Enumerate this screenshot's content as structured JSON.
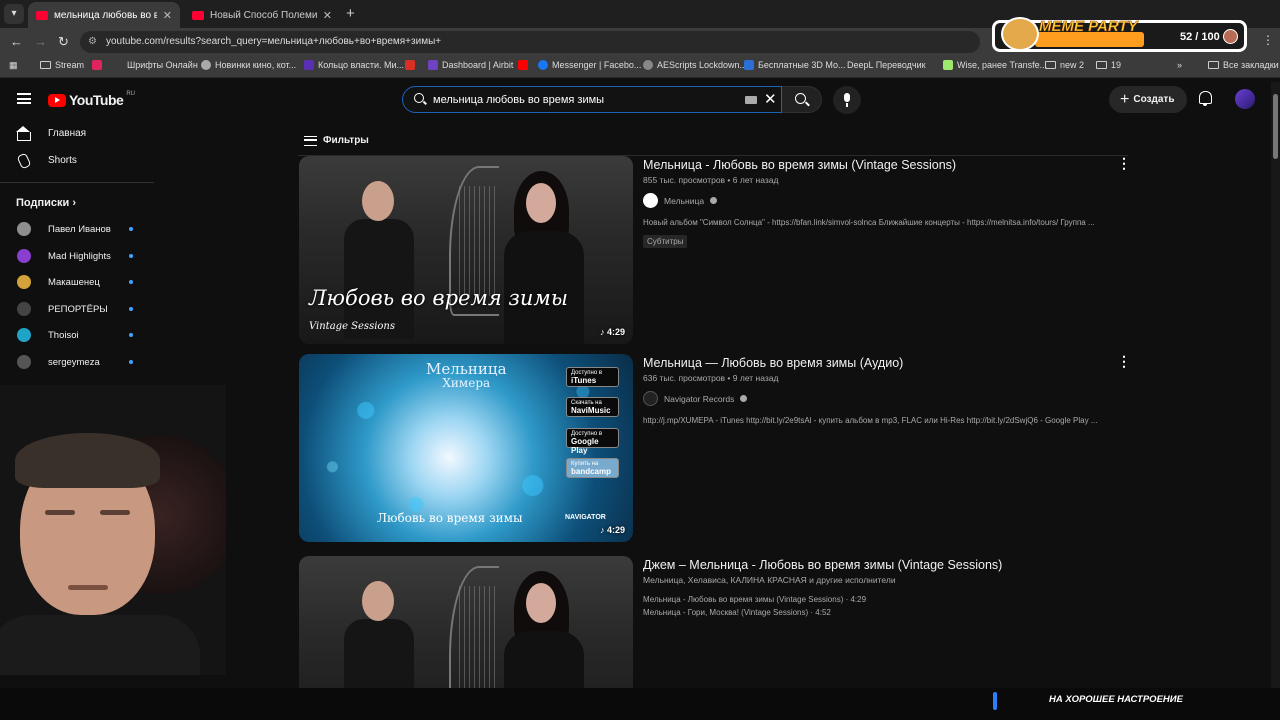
{
  "browser": {
    "tabs": [
      {
        "title": "мельница любовь во время з"
      },
      {
        "title": "Новый Способ Полемики Ра..."
      }
    ],
    "url": "youtube.com/results?search_query=мельница+любовь+во+время+зимы+",
    "bookmarks": [
      "Stream",
      "Шрифты Онлайн",
      "Новинки кино, кот...",
      "Кольцо власти. Ми...",
      "Dashboard | Airbit",
      "Messenger | Facebo...",
      "AEScripts Lockdown...",
      "Бесплатные 3D Мо...",
      "DeepL Переводчик",
      "Wise, ранее Transfe...",
      "new 2",
      "19",
      "Все закладки"
    ]
  },
  "overlay": {
    "title": "MEME PARTY",
    "count": "52 / 100",
    "progress": 0.52
  },
  "youtube": {
    "logo": "YouTube",
    "region": "RU",
    "search_value": "мельница любовь во время зимы",
    "create_label": "Создать",
    "sidebar": {
      "home": "Главная",
      "shorts": "Shorts",
      "subs_title": "Подписки",
      "subscriptions": [
        {
          "name": "Павел Иванов",
          "color": "#8f8f8f"
        },
        {
          "name": "Mad Highlights",
          "color": "#8b3fd1"
        },
        {
          "name": "Макашенец",
          "color": "#d4a23a"
        },
        {
          "name": "РЕПОРТЁРЫ",
          "color": "#444444"
        },
        {
          "name": "Thoisoi",
          "color": "#1fa3c7"
        },
        {
          "name": "sergeymeza",
          "color": "#555555"
        }
      ]
    },
    "filters_label": "Фильтры",
    "results": [
      {
        "title": "Мельница - Любовь во время зимы (Vintage Sessions)",
        "meta": "855 тыс. просмотров • 6 лет назад",
        "channel": "Мельница",
        "description": "Новый альбом \"Символ Солнца\" - https://bfan.link/simvol-solnca Ближайшие концерты - https://melnitsa.info/tours/ Группа ...",
        "badge": "Субтитры",
        "duration": "4:29",
        "overlay_title": "Любовь во время зимы",
        "overlay_sub": "Vintage Sessions"
      },
      {
        "title": "Мельница — Любовь во время зимы (Аудио)",
        "meta": "636 тыс. просмотров • 9 лет назад",
        "channel": "Navigator Records",
        "description": "http://j.mp/XUMEPA - iTunes http://bit.ly/2e9tsAl - купить альбом в mp3, FLAC или Hi-Res http://bit.ly/2dSwjQ6 - Google Play ...",
        "duration": "4:29",
        "art_title": "Мельница",
        "art_subtitle": "Химера",
        "art_bottom": "Любовь во время зимы",
        "art_label": "NAVIGATOR",
        "stores": [
          {
            "small": "Доступно в",
            "big": "iTunes"
          },
          {
            "small": "Скачать на",
            "big": "NaviMusic"
          },
          {
            "small": "Доступно в",
            "big": "Google Play"
          },
          {
            "small": "Купить на",
            "big": "bandcamp"
          }
        ]
      },
      {
        "title": "Джем – Мельница - Любовь во время зимы (Vintage Sessions)",
        "meta": "Мельница, Хелависа, КАЛИНА КРАСНАЯ и другие исполнители",
        "line1": "Мельница - Любовь во время зимы (Vintage Sessions) · 4:29",
        "line2": "Мельница - Гори, Москва! (Vintage Sessions) · 4:52"
      }
    ]
  },
  "bottom_band": {
    "text": "НА ХОРОШЕЕ НАСТРОЕНИЕ"
  }
}
